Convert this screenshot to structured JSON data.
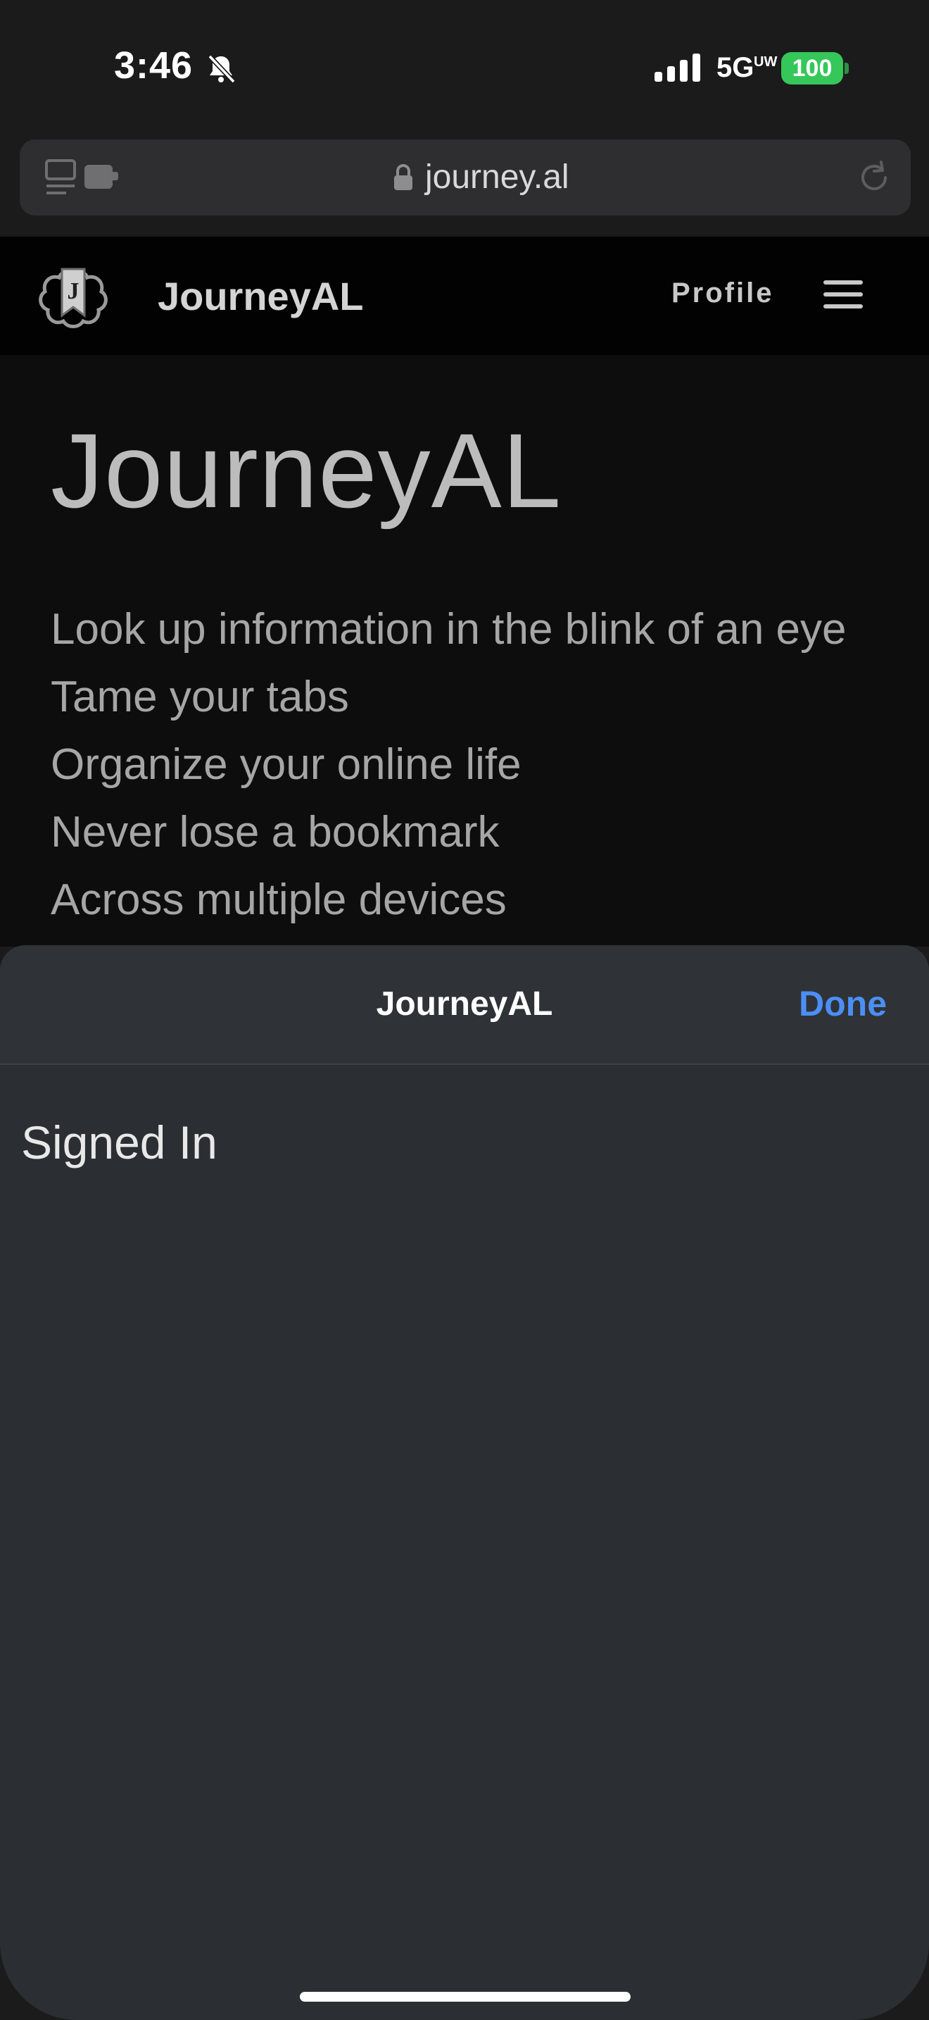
{
  "status_bar": {
    "time": "3:46",
    "network": "5G",
    "network_sub": "UW",
    "battery": "100"
  },
  "browser": {
    "url": "journey.al"
  },
  "site_nav": {
    "brand": "JourneyAL",
    "profile_label": "Profile",
    "logo_letter": "J"
  },
  "hero": {
    "title": "JourneyAL",
    "taglines": [
      "Look up information in the blink of an eye",
      "Tame your tabs",
      "Organize your online life",
      "Never lose a bookmark",
      "Across multiple devices"
    ]
  },
  "sheet": {
    "title": "JourneyAL",
    "done_label": "Done",
    "content_text": "Signed In"
  },
  "colors": {
    "accent": "#4b8ff5",
    "battery": "#35c759",
    "sheet_bg": "#2b2e32"
  },
  "icons": [
    "bell-slash-icon",
    "signal-bars-icon",
    "tabs-icon",
    "lock-icon",
    "reload-icon",
    "logo-icon",
    "hamburger-menu-icon"
  ]
}
